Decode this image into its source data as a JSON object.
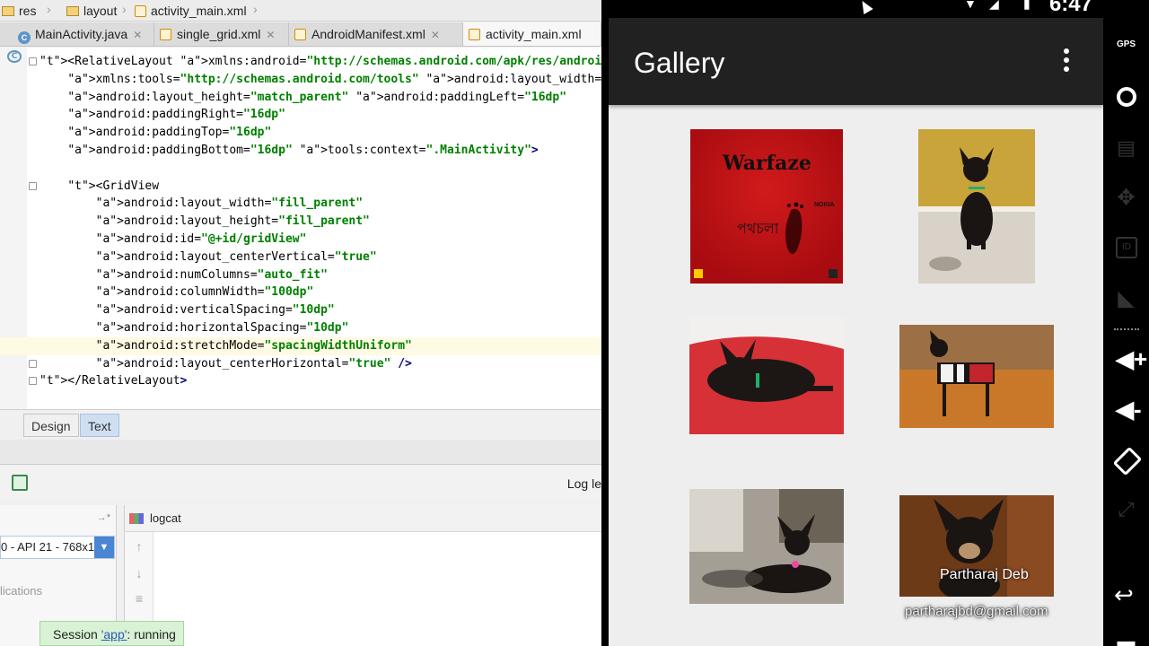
{
  "ide": {
    "breadcrumb": [
      "res",
      "layout",
      "activity_main.xml"
    ],
    "tabs": [
      {
        "label": "MainActivity.java",
        "type": "java"
      },
      {
        "label": "single_grid.xml",
        "type": "xml"
      },
      {
        "label": "AndroidManifest.xml",
        "type": "xml"
      },
      {
        "label": "activity_main.xml",
        "type": "xml",
        "active": true
      }
    ],
    "code_lines": [
      "<RelativeLayout xmlns:android=\"http://schemas.android.com/apk/res/android\"",
      "    xmlns:tools=\"http://schemas.android.com/tools\" android:layout_width=\"matc",
      "    android:layout_height=\"match_parent\" android:paddingLeft=\"16dp\"",
      "    android:paddingRight=\"16dp\"",
      "    android:paddingTop=\"16dp\"",
      "    android:paddingBottom=\"16dp\" tools:context=\".MainActivity\">",
      "",
      "    <GridView",
      "        android:layout_width=\"fill_parent\"",
      "        android:layout_height=\"fill_parent\"",
      "        android:id=\"@+id/gridView\"",
      "        android:layout_centerVertical=\"true\"",
      "        android:numColumns=\"auto_fit\"",
      "        android:columnWidth=\"100dp\"",
      "        android:verticalSpacing=\"10dp\"",
      "        android:horizontalSpacing=\"10dp\"",
      "        android:stretchMode=\"spacingWidthUniform\"",
      "        android:layout_centerHorizontal=\"true\" />",
      "</RelativeLayout>"
    ],
    "highlighted_line": 16,
    "editor_tabs": [
      "Design",
      "Text"
    ],
    "active_editor_tab": "Text",
    "log_level_label": "Log le",
    "device_select": "0 - API 21 - 768x1",
    "apps_label": "lications",
    "logcat_label": "logcat",
    "session": {
      "prefix": "Session ",
      "app": "'app'",
      "suffix": ": running"
    }
  },
  "emulator": {
    "app_title": "Gallery",
    "time": "6:47",
    "overlay_credit": "Partharaj Deb",
    "overlay_email": "partharajbd@gmail.com",
    "thumbnails": [
      {
        "name": "warfaze-album-cover",
        "text": "Warfaze",
        "subtext": "পথচলা",
        "brand": "NOKIA"
      },
      {
        "name": "chihuahua-standing"
      },
      {
        "name": "chihuahua-on-red-pillow"
      },
      {
        "name": "chihuahua-in-sweater"
      },
      {
        "name": "chihuahua-lying-indoors"
      },
      {
        "name": "chihuahua-portrait"
      }
    ]
  },
  "controls": {
    "gps": "GPS",
    "id": "ID"
  }
}
